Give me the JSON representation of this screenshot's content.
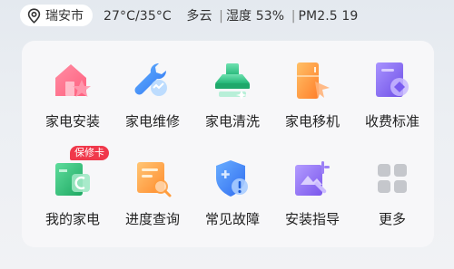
{
  "location": {
    "city": "瑞安市"
  },
  "weather": {
    "temp": "27°C/35°C",
    "condition": "多云",
    "humidity": "湿度 53%",
    "pm": "PM2.5 19",
    "separator": "|"
  },
  "services": [
    {
      "label": "家电安装",
      "icon": "house-install-icon"
    },
    {
      "label": "家电维修",
      "icon": "wrench-repair-icon"
    },
    {
      "label": "家电清洗",
      "icon": "range-hood-clean-icon"
    },
    {
      "label": "家电移机",
      "icon": "appliance-move-icon"
    },
    {
      "label": "收费标准",
      "icon": "fee-standard-icon"
    },
    {
      "label": "我的家电",
      "icon": "my-appliance-icon",
      "badge": "保修卡"
    },
    {
      "label": "进度查询",
      "icon": "progress-query-icon"
    },
    {
      "label": "常见故障",
      "icon": "faq-fault-icon"
    },
    {
      "label": "安装指导",
      "icon": "install-guide-icon"
    },
    {
      "label": "更多",
      "icon": "more-grid-icon"
    }
  ],
  "colors": {
    "install": "#ff6f8a",
    "repair": "#3f8cff",
    "clean": "#2fc48a",
    "move": "#ff9c3a",
    "fee": "#8b6cf0",
    "mine": "#27c07a",
    "progress": "#ff9d3e",
    "fault": "#3c7dfb",
    "guide": "#8f6ef2",
    "more": "#c7c9cf",
    "badge": "#f0384b"
  }
}
